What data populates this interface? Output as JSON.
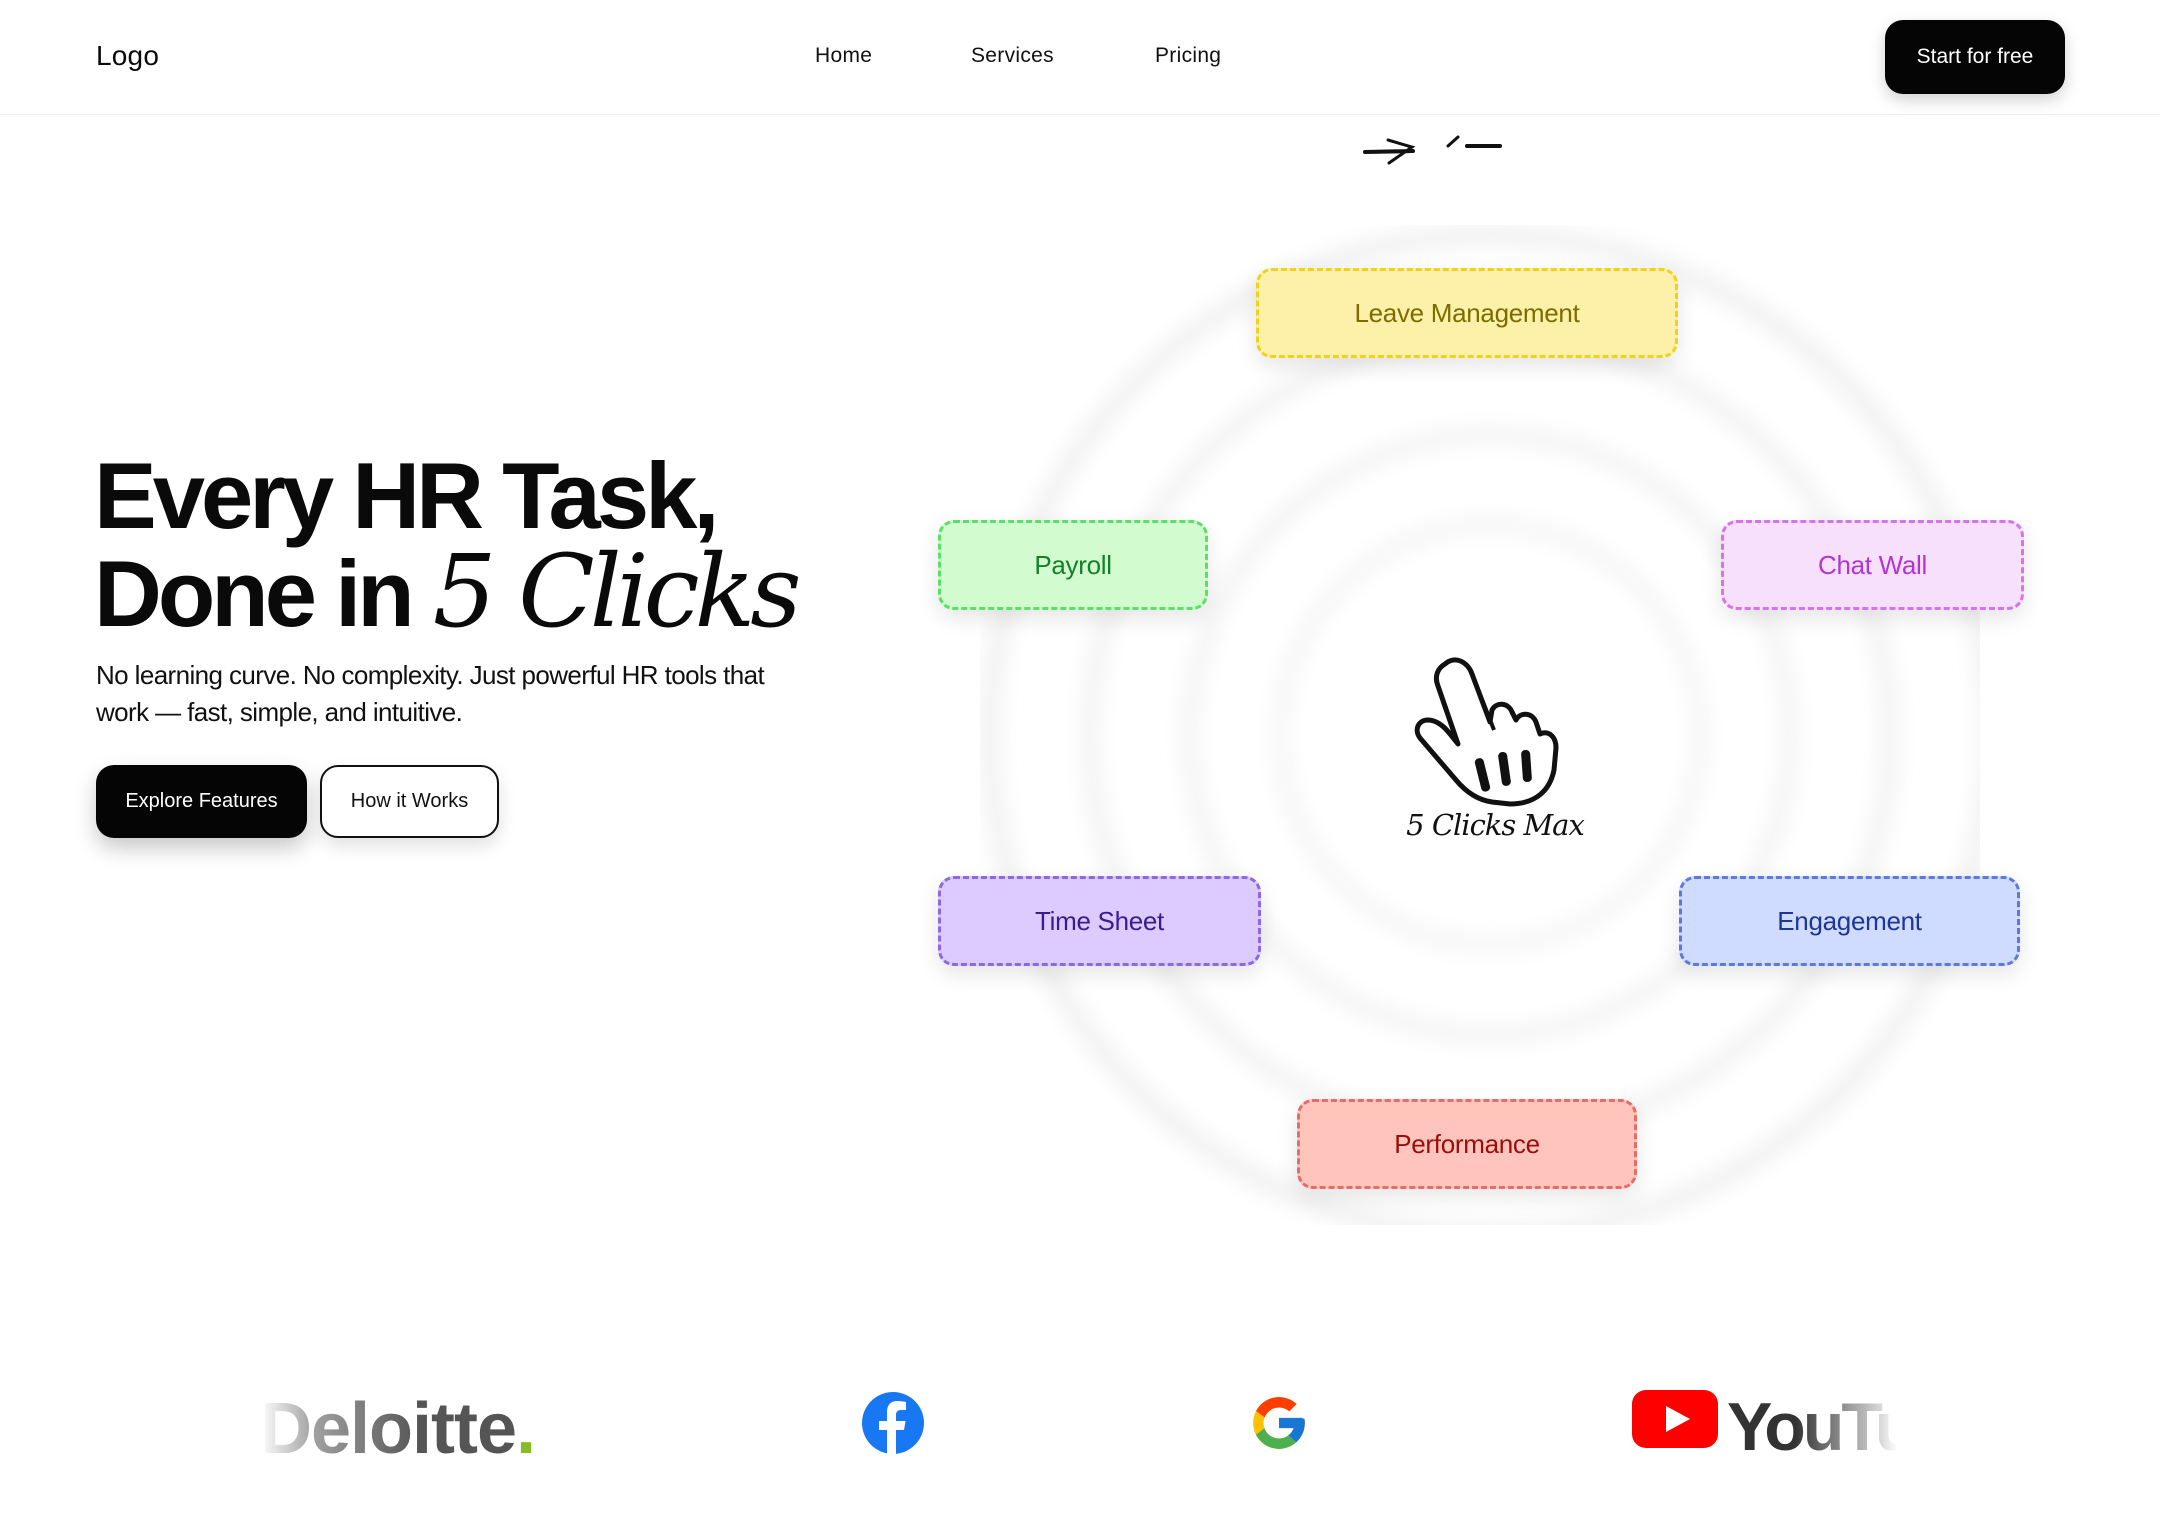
{
  "nav": {
    "logo": "Logo",
    "links": [
      "Home",
      "Services",
      "Pricing"
    ],
    "cta": "Start for free"
  },
  "hero": {
    "title_line1": "Every HR Task,",
    "title_line2_prefix": "Done in ",
    "title_line2_script": "5 Clicks",
    "subtitle": "No learning curve. No complexity. Just powerful HR tools that work — fast, simple, and intuitive.",
    "primary_button": "Explore Features",
    "secondary_button": "How it Works"
  },
  "diagram": {
    "center_label": "5 Clicks Max",
    "modules": [
      {
        "label": "Leave Management",
        "color": "#fdf1a9"
      },
      {
        "label": "Payroll",
        "color": "#d2fccf"
      },
      {
        "label": "Chat Wall",
        "color": "#f6e0fc"
      },
      {
        "label": "Time Sheet",
        "color": "#dccbff"
      },
      {
        "label": "Engagement",
        "color": "#cfdcff"
      },
      {
        "label": "Performance",
        "color": "#ffc5bd"
      }
    ]
  },
  "partners": {
    "deloitte_text": "Deloitte",
    "youtube_text": "YouTube",
    "logos": [
      "deloitte-logo",
      "facebook-icon",
      "google-icon",
      "youtube-logo"
    ]
  }
}
